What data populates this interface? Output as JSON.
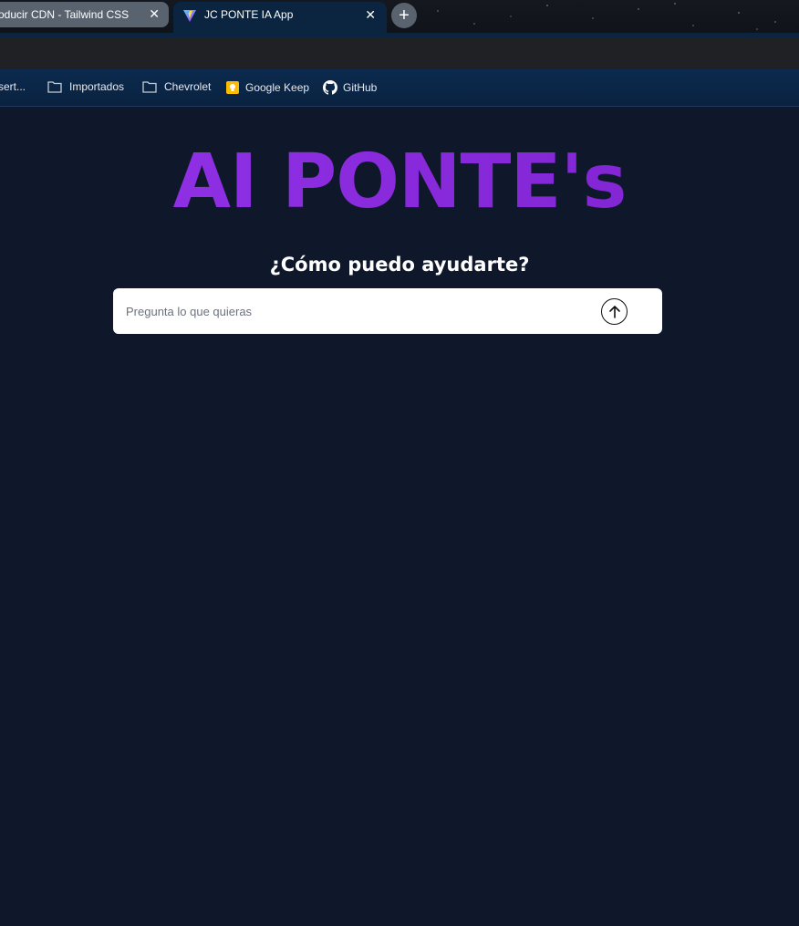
{
  "browser": {
    "tabs": [
      {
        "title": "roducir CDN - Tailwind CSS",
        "active": false
      },
      {
        "title": "JC PONTE IA App",
        "active": true,
        "favicon": "vite-icon"
      }
    ],
    "close_glyph": "✕",
    "new_tab_glyph": "+",
    "bookmarks": [
      {
        "label": "sert...",
        "icon": "none"
      },
      {
        "label": "Importados",
        "icon": "folder-icon"
      },
      {
        "label": "Chevrolet",
        "icon": "folder-icon"
      },
      {
        "label": "Google Keep",
        "icon": "google-keep-icon"
      },
      {
        "label": "GitHub",
        "icon": "github-icon"
      }
    ]
  },
  "page": {
    "heading": "AI PONTE's",
    "subheading": "¿Cómo puedo ayudarte?",
    "prompt_placeholder": "Pregunta lo que quieras",
    "send_icon": "arrow-up-icon",
    "colors": {
      "background": "#0f172a",
      "heading_gradient_start": "#9333ea",
      "heading_gradient_end": "#7e22ce"
    }
  }
}
